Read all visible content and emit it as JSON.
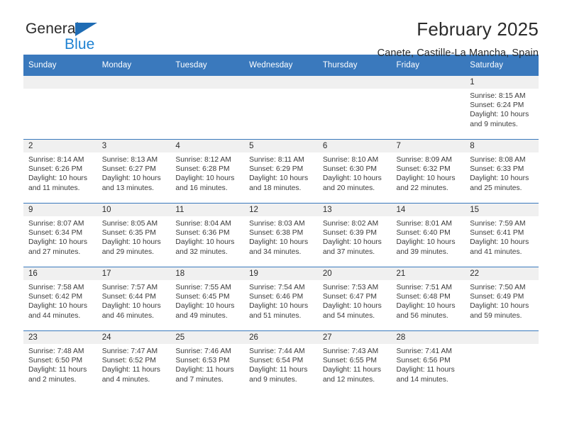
{
  "brand": {
    "name_part1": "General",
    "name_part2": "Blue",
    "triangle_color": "#1f6cb4",
    "blue_color": "#1f82d2"
  },
  "header": {
    "title": "February 2025",
    "subtitle": "Canete, Castille-La Mancha, Spain"
  },
  "theme": {
    "header_bg": "#3a79bd",
    "daynum_bg": "#f0f0f0",
    "text": "#2b2b2b",
    "grid_line": "#3a79bd"
  },
  "calendar": {
    "weekday_headers": [
      "Sunday",
      "Monday",
      "Tuesday",
      "Wednesday",
      "Thursday",
      "Friday",
      "Saturday"
    ],
    "labels": {
      "sunrise": "Sunrise:",
      "sunset": "Sunset:",
      "daylight": "Daylight:"
    },
    "weeks": [
      [
        {
          "day": "",
          "sunrise": "",
          "sunset": "",
          "daylight": "",
          "blank": true
        },
        {
          "day": "",
          "sunrise": "",
          "sunset": "",
          "daylight": "",
          "blank": true
        },
        {
          "day": "",
          "sunrise": "",
          "sunset": "",
          "daylight": "",
          "blank": true
        },
        {
          "day": "",
          "sunrise": "",
          "sunset": "",
          "daylight": "",
          "blank": true
        },
        {
          "day": "",
          "sunrise": "",
          "sunset": "",
          "daylight": "",
          "blank": true
        },
        {
          "day": "",
          "sunrise": "",
          "sunset": "",
          "daylight": "",
          "blank": true
        },
        {
          "day": "1",
          "sunrise": "Sunrise: 8:15 AM",
          "sunset": "Sunset: 6:24 PM",
          "daylight": "Daylight: 10 hours and 9 minutes.",
          "blank": false
        }
      ],
      [
        {
          "day": "2",
          "sunrise": "Sunrise: 8:14 AM",
          "sunset": "Sunset: 6:26 PM",
          "daylight": "Daylight: 10 hours and 11 minutes.",
          "blank": false
        },
        {
          "day": "3",
          "sunrise": "Sunrise: 8:13 AM",
          "sunset": "Sunset: 6:27 PM",
          "daylight": "Daylight: 10 hours and 13 minutes.",
          "blank": false
        },
        {
          "day": "4",
          "sunrise": "Sunrise: 8:12 AM",
          "sunset": "Sunset: 6:28 PM",
          "daylight": "Daylight: 10 hours and 16 minutes.",
          "blank": false
        },
        {
          "day": "5",
          "sunrise": "Sunrise: 8:11 AM",
          "sunset": "Sunset: 6:29 PM",
          "daylight": "Daylight: 10 hours and 18 minutes.",
          "blank": false
        },
        {
          "day": "6",
          "sunrise": "Sunrise: 8:10 AM",
          "sunset": "Sunset: 6:30 PM",
          "daylight": "Daylight: 10 hours and 20 minutes.",
          "blank": false
        },
        {
          "day": "7",
          "sunrise": "Sunrise: 8:09 AM",
          "sunset": "Sunset: 6:32 PM",
          "daylight": "Daylight: 10 hours and 22 minutes.",
          "blank": false
        },
        {
          "day": "8",
          "sunrise": "Sunrise: 8:08 AM",
          "sunset": "Sunset: 6:33 PM",
          "daylight": "Daylight: 10 hours and 25 minutes.",
          "blank": false
        }
      ],
      [
        {
          "day": "9",
          "sunrise": "Sunrise: 8:07 AM",
          "sunset": "Sunset: 6:34 PM",
          "daylight": "Daylight: 10 hours and 27 minutes.",
          "blank": false
        },
        {
          "day": "10",
          "sunrise": "Sunrise: 8:05 AM",
          "sunset": "Sunset: 6:35 PM",
          "daylight": "Daylight: 10 hours and 29 minutes.",
          "blank": false
        },
        {
          "day": "11",
          "sunrise": "Sunrise: 8:04 AM",
          "sunset": "Sunset: 6:36 PM",
          "daylight": "Daylight: 10 hours and 32 minutes.",
          "blank": false
        },
        {
          "day": "12",
          "sunrise": "Sunrise: 8:03 AM",
          "sunset": "Sunset: 6:38 PM",
          "daylight": "Daylight: 10 hours and 34 minutes.",
          "blank": false
        },
        {
          "day": "13",
          "sunrise": "Sunrise: 8:02 AM",
          "sunset": "Sunset: 6:39 PM",
          "daylight": "Daylight: 10 hours and 37 minutes.",
          "blank": false
        },
        {
          "day": "14",
          "sunrise": "Sunrise: 8:01 AM",
          "sunset": "Sunset: 6:40 PM",
          "daylight": "Daylight: 10 hours and 39 minutes.",
          "blank": false
        },
        {
          "day": "15",
          "sunrise": "Sunrise: 7:59 AM",
          "sunset": "Sunset: 6:41 PM",
          "daylight": "Daylight: 10 hours and 41 minutes.",
          "blank": false
        }
      ],
      [
        {
          "day": "16",
          "sunrise": "Sunrise: 7:58 AM",
          "sunset": "Sunset: 6:42 PM",
          "daylight": "Daylight: 10 hours and 44 minutes.",
          "blank": false
        },
        {
          "day": "17",
          "sunrise": "Sunrise: 7:57 AM",
          "sunset": "Sunset: 6:44 PM",
          "daylight": "Daylight: 10 hours and 46 minutes.",
          "blank": false
        },
        {
          "day": "18",
          "sunrise": "Sunrise: 7:55 AM",
          "sunset": "Sunset: 6:45 PM",
          "daylight": "Daylight: 10 hours and 49 minutes.",
          "blank": false
        },
        {
          "day": "19",
          "sunrise": "Sunrise: 7:54 AM",
          "sunset": "Sunset: 6:46 PM",
          "daylight": "Daylight: 10 hours and 51 minutes.",
          "blank": false
        },
        {
          "day": "20",
          "sunrise": "Sunrise: 7:53 AM",
          "sunset": "Sunset: 6:47 PM",
          "daylight": "Daylight: 10 hours and 54 minutes.",
          "blank": false
        },
        {
          "day": "21",
          "sunrise": "Sunrise: 7:51 AM",
          "sunset": "Sunset: 6:48 PM",
          "daylight": "Daylight: 10 hours and 56 minutes.",
          "blank": false
        },
        {
          "day": "22",
          "sunrise": "Sunrise: 7:50 AM",
          "sunset": "Sunset: 6:49 PM",
          "daylight": "Daylight: 10 hours and 59 minutes.",
          "blank": false
        }
      ],
      [
        {
          "day": "23",
          "sunrise": "Sunrise: 7:48 AM",
          "sunset": "Sunset: 6:50 PM",
          "daylight": "Daylight: 11 hours and 2 minutes.",
          "blank": false
        },
        {
          "day": "24",
          "sunrise": "Sunrise: 7:47 AM",
          "sunset": "Sunset: 6:52 PM",
          "daylight": "Daylight: 11 hours and 4 minutes.",
          "blank": false
        },
        {
          "day": "25",
          "sunrise": "Sunrise: 7:46 AM",
          "sunset": "Sunset: 6:53 PM",
          "daylight": "Daylight: 11 hours and 7 minutes.",
          "blank": false
        },
        {
          "day": "26",
          "sunrise": "Sunrise: 7:44 AM",
          "sunset": "Sunset: 6:54 PM",
          "daylight": "Daylight: 11 hours and 9 minutes.",
          "blank": false
        },
        {
          "day": "27",
          "sunrise": "Sunrise: 7:43 AM",
          "sunset": "Sunset: 6:55 PM",
          "daylight": "Daylight: 11 hours and 12 minutes.",
          "blank": false
        },
        {
          "day": "28",
          "sunrise": "Sunrise: 7:41 AM",
          "sunset": "Sunset: 6:56 PM",
          "daylight": "Daylight: 11 hours and 14 minutes.",
          "blank": false
        },
        {
          "day": "",
          "sunrise": "",
          "sunset": "",
          "daylight": "",
          "blank": true
        }
      ]
    ]
  }
}
